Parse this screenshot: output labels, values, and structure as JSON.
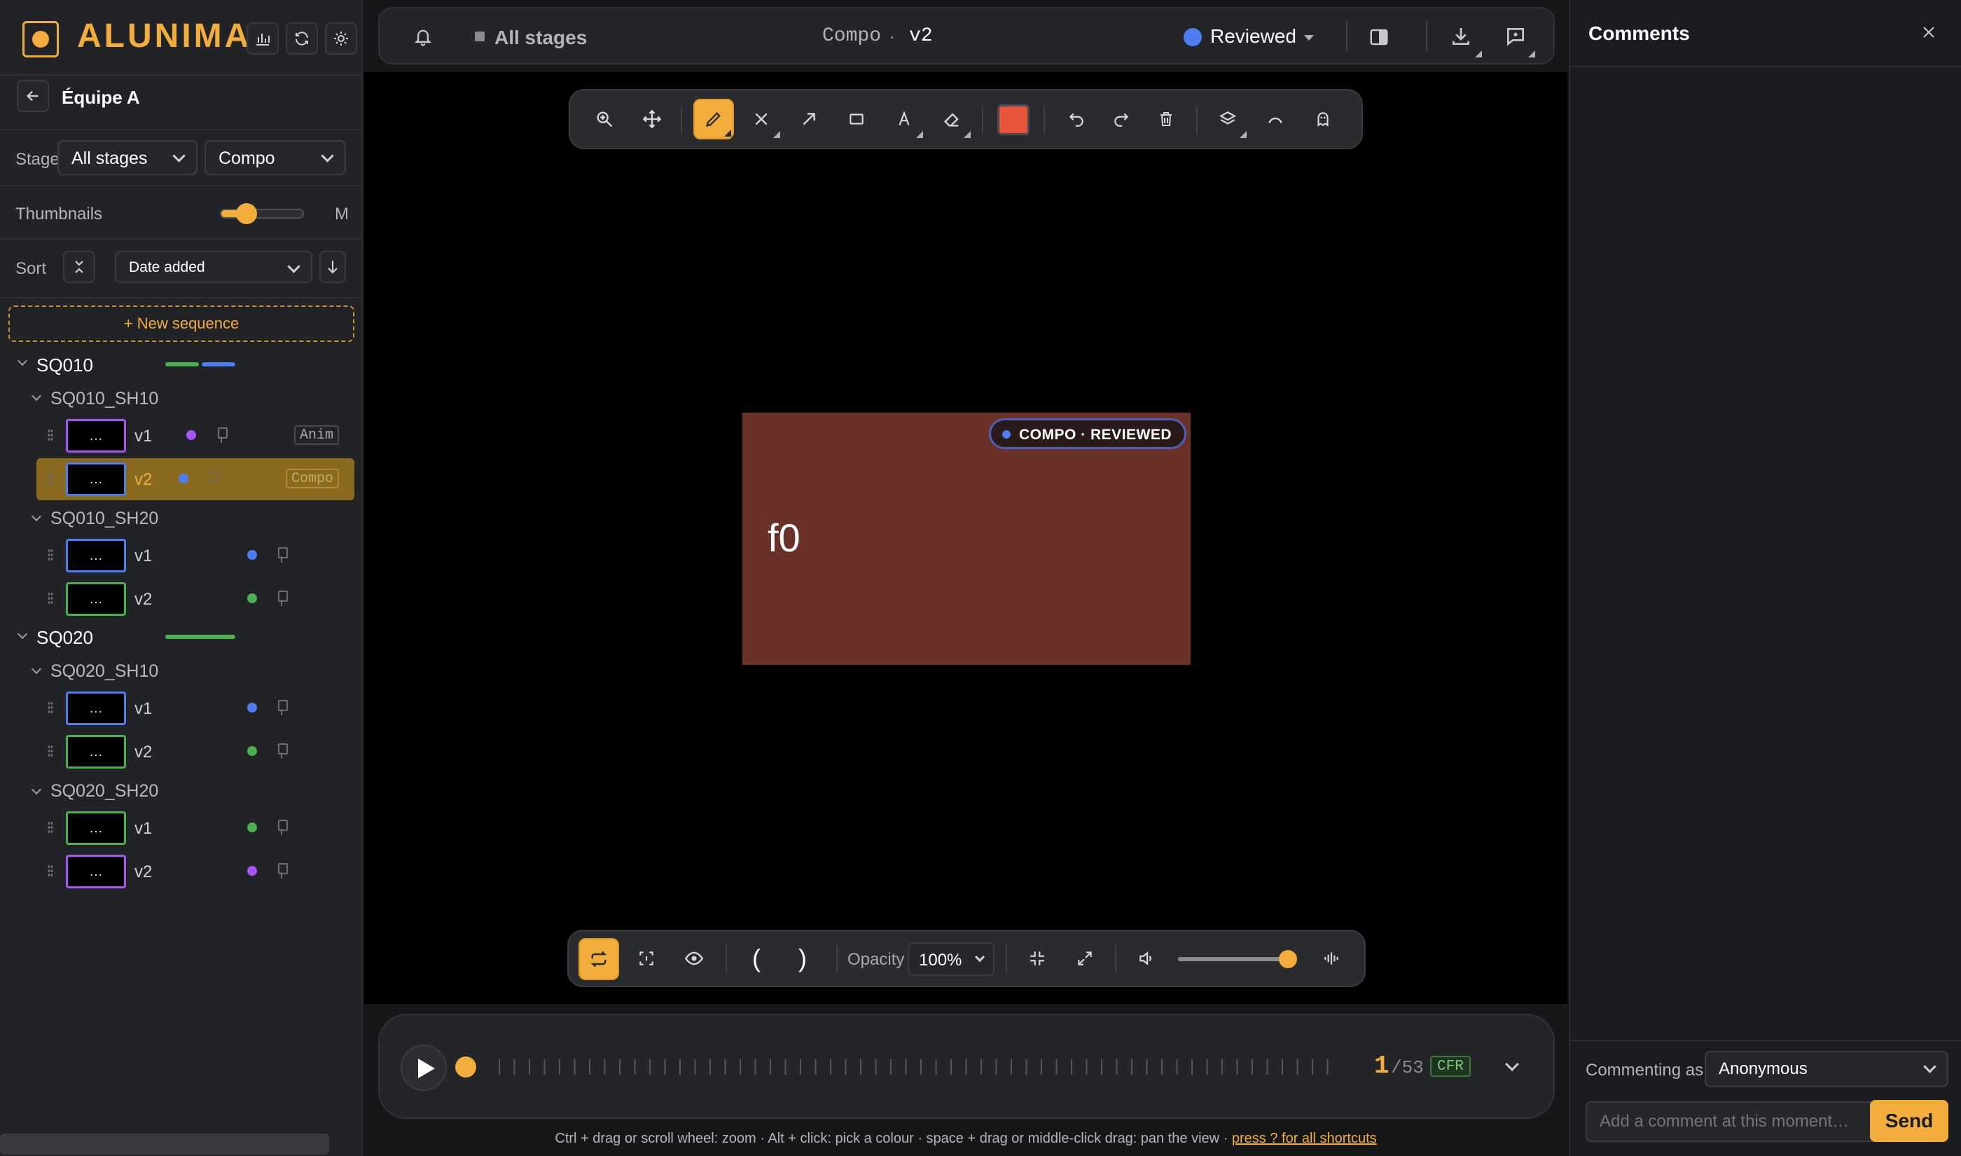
{
  "app": {
    "name": "ALUNIMA"
  },
  "sidebar": {
    "team": "Équipe A",
    "stage_label": "Stage",
    "stage_value": "All stages",
    "dept_value": "Compo",
    "thumbnails_label": "Thumbnails",
    "thumbnails_size": "M",
    "thumbnails_level": 0.3,
    "sort_label": "Sort",
    "sort_value": "Date added",
    "new_sequence": "+ New sequence",
    "sequences": [
      {
        "name": "SQ010",
        "shots": [
          {
            "name": "SQ010_SH10",
            "versions": [
              {
                "label": "v1",
                "thumb": "…",
                "status_color": "#a855f7",
                "tag": "Anim"
              },
              {
                "label": "v2",
                "thumb": "…",
                "status_color": "#4f7cf0",
                "tag": "Compo",
                "selected": true
              }
            ]
          },
          {
            "name": "SQ010_SH20",
            "versions": [
              {
                "label": "v1",
                "thumb": "…",
                "status_color": "#4f7cf0"
              },
              {
                "label": "v2",
                "thumb": "…",
                "status_color": "#4caf50"
              }
            ]
          }
        ]
      },
      {
        "name": "SQ020",
        "shots": [
          {
            "name": "SQ020_SH10",
            "versions": [
              {
                "label": "v1",
                "thumb": "…",
                "status_color": "#4f7cf0"
              },
              {
                "label": "v2",
                "thumb": "…",
                "status_color": "#4caf50"
              }
            ]
          },
          {
            "name": "SQ020_SH20",
            "versions": [
              {
                "label": "v1",
                "thumb": "…",
                "status_color": "#4caf50"
              },
              {
                "label": "v2",
                "thumb": "…",
                "status_color": "#a855f7"
              }
            ]
          }
        ]
      }
    ]
  },
  "topbar": {
    "filter": "All stages",
    "shot_title": "Compo",
    "separator": "·",
    "version": "v2",
    "status": "Reviewed",
    "status_color": "#4f7cf0"
  },
  "toolbar": {
    "color_swatch": "#e8553a"
  },
  "viewer": {
    "badge": "COMPO · REVIEWED",
    "frame_text": "f0",
    "frame_color": "#6a3129"
  },
  "playback": {
    "opacity_label": "Opacity",
    "opacity_value": "100%",
    "in_mark": "(",
    "out_mark": ")",
    "volume_level": 1.0
  },
  "timeline": {
    "frame": "1",
    "total": "/53",
    "mode": "CFR"
  },
  "footer": {
    "hint": "Ctrl + drag or scroll wheel: zoom · Alt + click: pick a colour · space + drag or middle-click drag: pan the view · ",
    "link": "press ? for all shortcuts"
  },
  "comments": {
    "title": "Comments",
    "commenting_as_label": "Commenting as",
    "commenting_as_value": "Anonymous",
    "input_placeholder": "Add a comment at this moment…",
    "send": "Send"
  },
  "colors": {
    "accent": "#f2ad3c",
    "blue": "#4f7cf0",
    "green": "#4caf50",
    "purple": "#a855f7"
  }
}
